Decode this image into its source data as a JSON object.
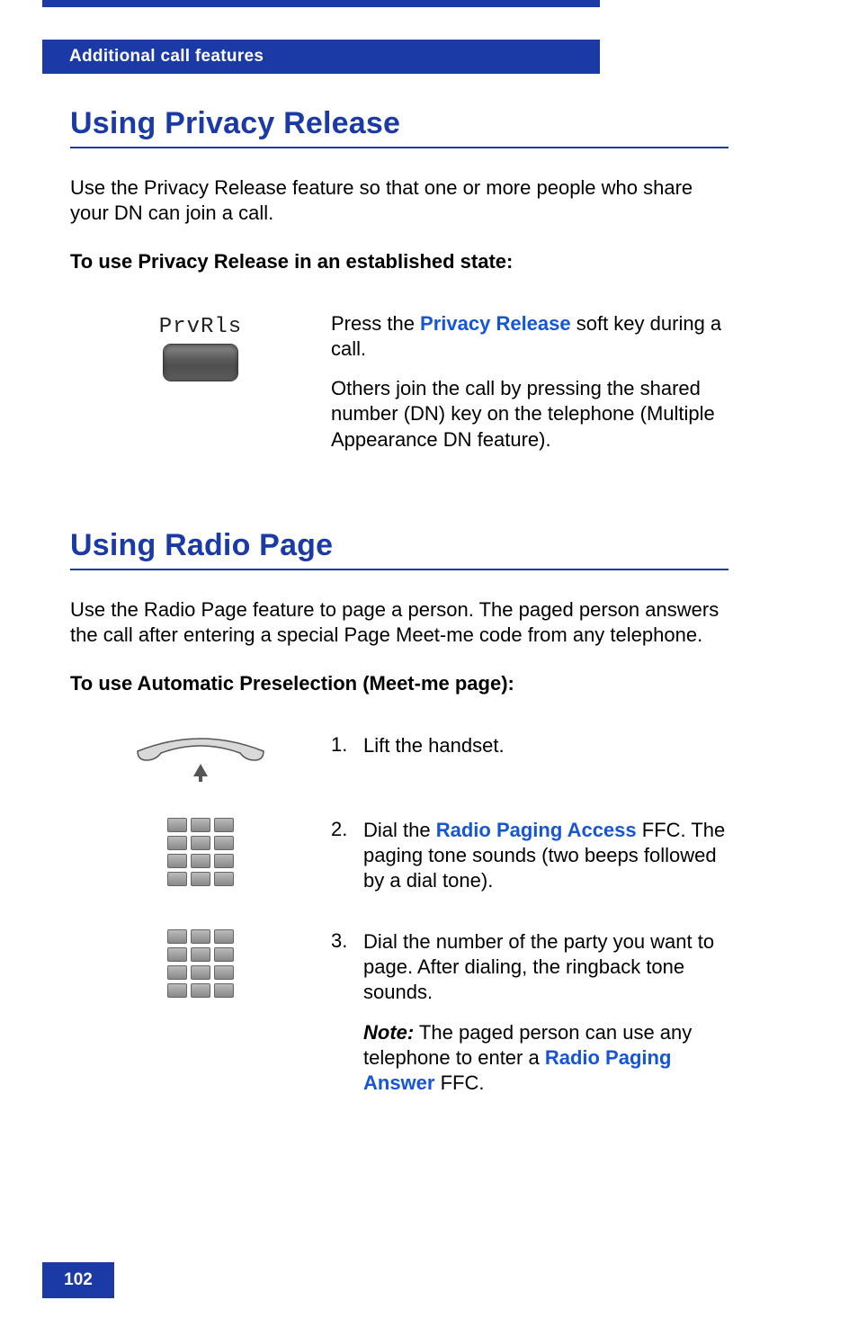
{
  "header": {
    "chapter": "Additional call features"
  },
  "section1": {
    "title": "Using Privacy Release",
    "intro": "Use the Privacy Release feature so that one or more people who share your DN can join a call.",
    "subhead": "To use Privacy Release in an established state:",
    "softkey_label": "PrvRls",
    "instr_prefix": "Press the ",
    "instr_term": "Privacy Release",
    "instr_suffix": " soft key during a call.",
    "instr2": "Others join the call by pressing the shared number (DN) key on the telephone (Multiple Appearance DN feature)."
  },
  "section2": {
    "title": "Using Radio Page",
    "intro": "Use the Radio Page feature to page a person. The paged person answers the call after entering a special Page Meet-me code from any telephone.",
    "subhead": "To use Automatic Preselection (Meet-me page):",
    "steps": {
      "s1": {
        "num": "1.",
        "text": "Lift the handset."
      },
      "s2": {
        "num": "2.",
        "prefix": "Dial the ",
        "term": "Radio Paging Access",
        "suffix": " FFC. The paging tone sounds (two beeps followed by a dial tone)."
      },
      "s3": {
        "num": "3.",
        "text": "Dial the number of the party you want to page. After dialing, the ringback tone sounds.",
        "note_label": "Note:",
        "note_prefix": " The paged person can use any telephone to enter a ",
        "note_term": "Radio Paging Answer",
        "note_suffix": " FFC."
      }
    }
  },
  "page_number": "102"
}
